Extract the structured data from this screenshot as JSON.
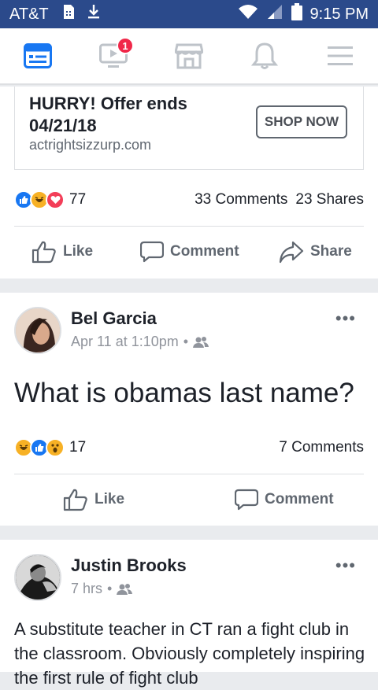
{
  "status_bar": {
    "carrier": "AT&T",
    "time": "9:15 PM"
  },
  "nav": {
    "video_badge": "1"
  },
  "ad": {
    "title": "HURRY! Offer ends 04/21/18",
    "url": "actrightsizzurp.com",
    "cta": "SHOP NOW",
    "reaction_count": "77",
    "comments": "33 Comments",
    "shares": "23 Shares"
  },
  "actions": {
    "like": "Like",
    "comment": "Comment",
    "share": "Share"
  },
  "post1": {
    "author": "Bel Garcia",
    "time": "Apr 11 at 1:10pm",
    "separator": "•",
    "text": "What is obamas last name?",
    "reaction_count": "17",
    "comments": "7 Comments"
  },
  "post2": {
    "author": "Justin Brooks",
    "time": "7 hrs",
    "separator": "•",
    "text": "A substitute teacher in CT ran a fight club in the classroom. Obviously completely inspiring the first rule of fight club"
  },
  "colors": {
    "status_bar": "#2b4a8b",
    "brand": "#1877f2",
    "badge": "#f02849"
  }
}
